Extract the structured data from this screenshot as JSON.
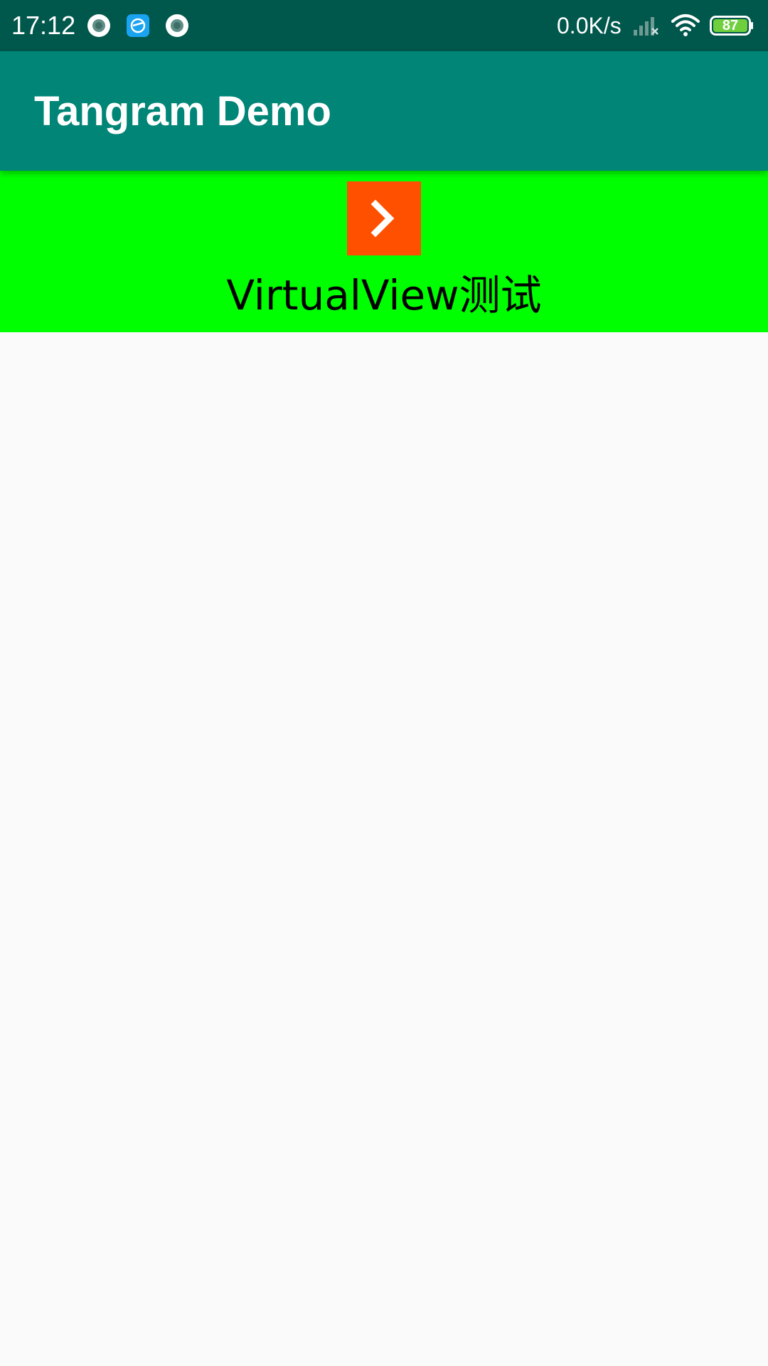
{
  "status_bar": {
    "time": "17:12",
    "notification_icons": [
      "record-icon",
      "browser-icon",
      "record-icon"
    ],
    "network_speed": "0.0K/s",
    "battery_level": "87",
    "background_color": "#00574b"
  },
  "app_bar": {
    "title": "Tangram Demo",
    "background_color": "#008577"
  },
  "card": {
    "background_color": "#00ff00",
    "icon_background_color": "#ff5000",
    "icon": "chevron-right-icon",
    "label": "VirtualView测试"
  },
  "page": {
    "background_color": "#fafafa"
  }
}
